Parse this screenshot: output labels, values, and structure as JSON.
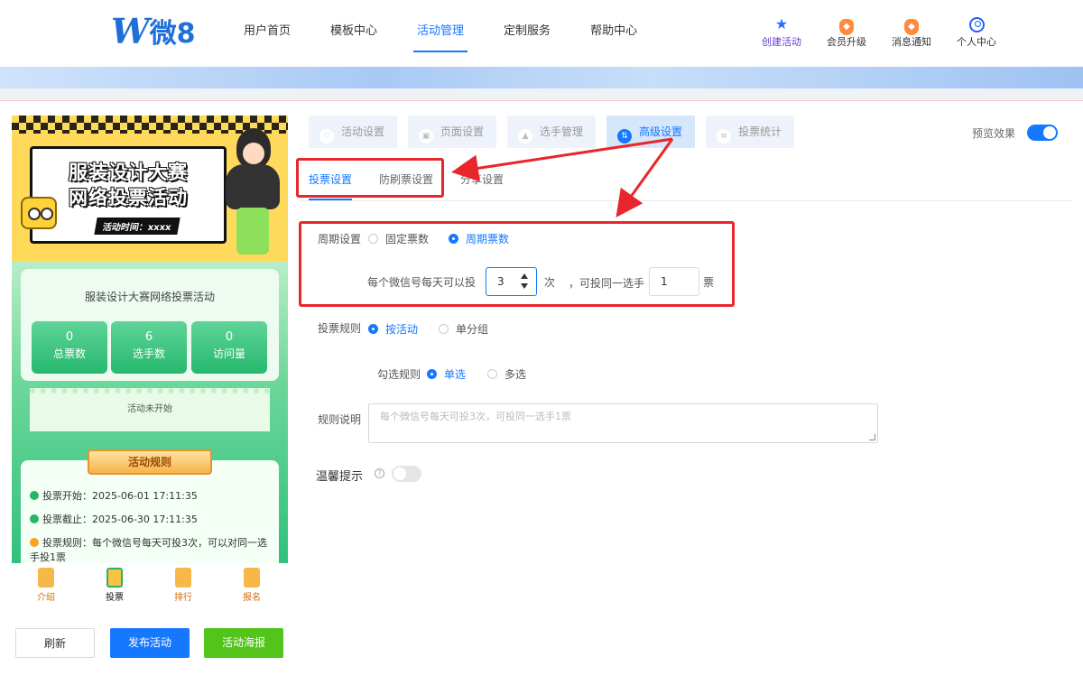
{
  "header": {
    "logo": {
      "w": "W",
      "text": "微8"
    },
    "nav": [
      "用户首页",
      "模板中心",
      "活动管理",
      "定制服务",
      "帮助中心"
    ],
    "nav_active": "活动管理",
    "actions": [
      {
        "label": "创建活动",
        "icon": "star-icon"
      },
      {
        "label": "会员升级",
        "icon": "badge-icon"
      },
      {
        "label": "消息通知",
        "icon": "bell-badge-icon"
      },
      {
        "label": "个人中心",
        "icon": "person-icon"
      }
    ]
  },
  "preview": {
    "poster_title_1": "服装设计大赛",
    "poster_title_2": "网络投票活动",
    "poster_time": "活动时间：xxxx",
    "stats_title": "服装设计大赛网络投票活动",
    "stats": [
      {
        "value": "0",
        "label": "总票数"
      },
      {
        "value": "6",
        "label": "选手数"
      },
      {
        "value": "0",
        "label": "访问量"
      }
    ],
    "status": "活动未开始",
    "rules_title": "活动规则",
    "rules": [
      "投票开始：2025-06-01 17:11:35",
      "投票截止：2025-06-30 17:11:35",
      "投票规则：每个微信号每天可投3次，可以对同一选手投1票"
    ],
    "tabbar": [
      "介绍",
      "投票",
      "排行",
      "报名"
    ],
    "tab_active": "投票"
  },
  "buttons": {
    "refresh": "刷新",
    "publish": "发布活动",
    "poster": "活动海报"
  },
  "steps": [
    "活动设置",
    "页面设置",
    "选手管理",
    "高级设置",
    "投票统计"
  ],
  "step_active": "高级设置",
  "preview_effect": {
    "label": "预览效果",
    "enabled": true
  },
  "subtabs": [
    "投票设置",
    "防刷票设置",
    "分享设置"
  ],
  "subtab_active": "投票设置",
  "form": {
    "period_label": "周期设置",
    "period_options": [
      "固定票数",
      "周期票数"
    ],
    "period_selected": "周期票数",
    "per_day_prefix": "每个微信号每天可以投",
    "per_day_value": "3",
    "per_day_unit": "次",
    "same_player_prefix": "，可投同一选手",
    "same_player_value": "1",
    "same_player_unit": "票",
    "vote_rule_label": "投票规则",
    "vote_rule_options": [
      "按活动",
      "单分组"
    ],
    "vote_rule_selected": "按活动",
    "select_rule_label": "勾选规则",
    "select_rule_options": [
      "单选",
      "多选"
    ],
    "select_rule_selected": "单选",
    "rule_desc_label": "规则说明",
    "rule_desc_placeholder": "每个微信号每天可投3次，可投同一选手1票",
    "tip_label": "温馨提示",
    "tip_enabled": false
  },
  "colors": {
    "primary": "#1677ff",
    "annotation": "#e8262b",
    "success": "#52c41a"
  }
}
